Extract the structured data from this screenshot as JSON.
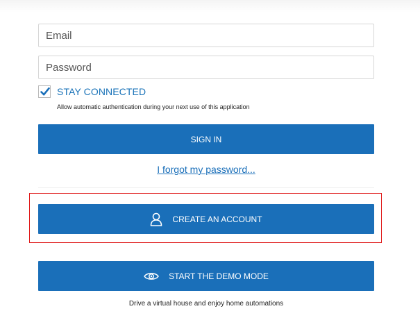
{
  "login": {
    "email_placeholder": "Email",
    "password_placeholder": "Password",
    "stay_connected_label": "STAY CONNECTED",
    "stay_connected_checked": true,
    "stay_connected_description": "Allow automatic authentication during your next use of this application",
    "sign_in_label": "SIGN IN",
    "forgot_password_label": "I forgot my password..."
  },
  "account": {
    "create_account_label": "CREATE AN ACCOUNT",
    "create_account_icon": "user-icon"
  },
  "demo": {
    "demo_mode_label": "START THE DEMO MODE",
    "demo_mode_icon": "eye-icon",
    "demo_description": "Drive a virtual house and enjoy home automations"
  },
  "colors": {
    "primary_button": "#1a6fb9",
    "accent_text": "#1a73b8",
    "highlight_border": "#e01b1b"
  }
}
